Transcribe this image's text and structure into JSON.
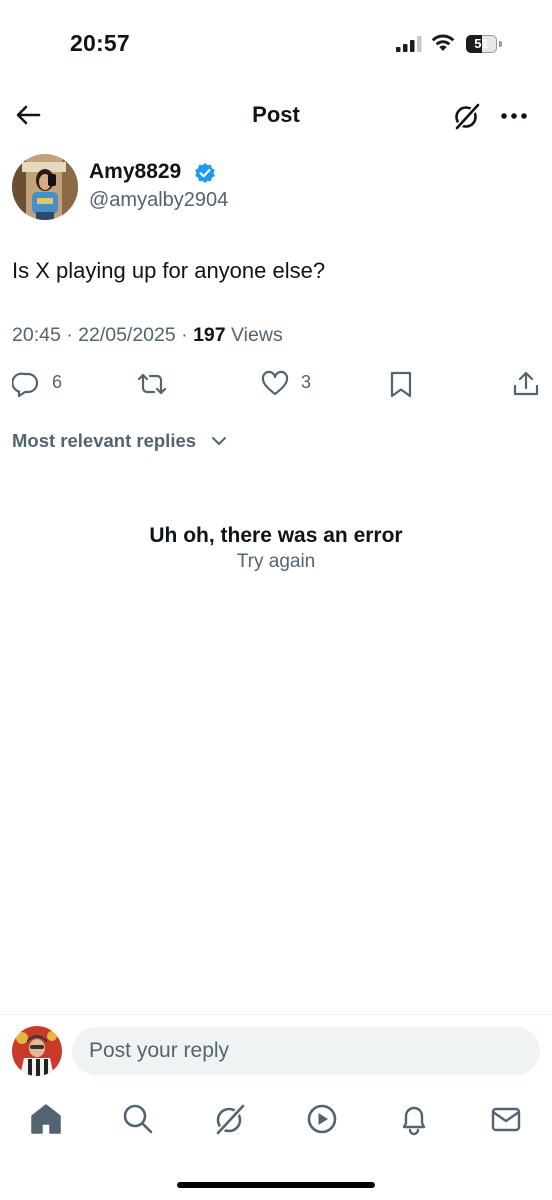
{
  "status_bar": {
    "time": "20:57",
    "battery_level": "51",
    "battery_percent": 51,
    "icons": [
      "signal-icon",
      "wifi-icon",
      "battery-icon"
    ]
  },
  "header": {
    "title": "Post",
    "icons": [
      "back-arrow-icon",
      "grok-icon",
      "more-icon"
    ]
  },
  "post": {
    "author": {
      "display_name": "Amy8829",
      "handle": "@amyalby2904",
      "verified": true
    },
    "text": "Is X playing up for anyone else?",
    "timestamp": "20:45 · 22/05/2025 · ",
    "views_count": "197",
    "views_label": " Views",
    "actions": {
      "replies": "6",
      "reposts": "",
      "likes": "3"
    }
  },
  "replies": {
    "sort_label": "Most relevant replies",
    "error_title": "Uh oh, there was an error",
    "retry_label": "Try again"
  },
  "reply_bar": {
    "placeholder": "Post your reply"
  },
  "tab_bar": {
    "items": [
      "home",
      "search",
      "grok",
      "video",
      "notifications",
      "messages"
    ]
  },
  "colors": {
    "text_primary": "#0f1419",
    "text_secondary": "#536471",
    "verified_blue": "#1d9bf0",
    "input_bg": "#eff3f4"
  }
}
